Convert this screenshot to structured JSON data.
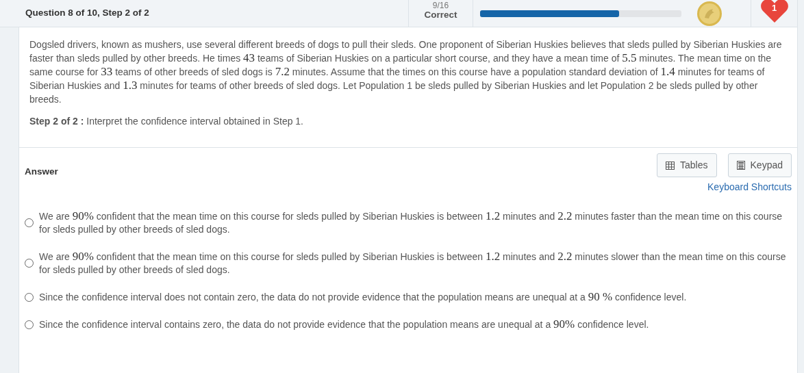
{
  "header": {
    "title": "Question 8 of 10, Step 2 of 2",
    "score": "9/16",
    "result": "Correct",
    "progress": {
      "level": 0.69
    },
    "lives": "1"
  },
  "problem": {
    "parts": [
      {
        "kind": "text",
        "text": "Dogsled drivers, known as mushers, use several different breeds of dogs to pull their sleds. One proponent of Siberian Huskies believes that sleds pulled by Siberian Huskies are faster than sleds pulled by other breeds. He times "
      },
      {
        "kind": "math",
        "text": "43"
      },
      {
        "kind": "text",
        "text": " teams of Siberian Huskies on a particular short course, and they have a mean time of "
      },
      {
        "kind": "math",
        "text": "5.5"
      },
      {
        "kind": "text",
        "text": " minutes. The mean time on the same course for "
      },
      {
        "kind": "math",
        "text": "33"
      },
      {
        "kind": "text",
        "text": " teams of other breeds of sled dogs is "
      },
      {
        "kind": "math",
        "text": "7.2"
      },
      {
        "kind": "text",
        "text": " minutes. Assume that the times on this course have a population standard deviation of "
      },
      {
        "kind": "math",
        "text": "1.4"
      },
      {
        "kind": "text",
        "text": " minutes for teams of Siberian Huskies and "
      },
      {
        "kind": "math",
        "text": "1.3"
      },
      {
        "kind": "text",
        "text": " minutes for teams of other breeds of sled dogs. Let Population 1 be sleds pulled by Siberian Huskies and let Population 2 be sleds pulled by other breeds."
      }
    ],
    "step_label": "Step 2 of 2 :",
    "step_text": "Interpret the confidence interval obtained in Step 1."
  },
  "answer": {
    "label": "Answer",
    "buttons": [
      {
        "kind": "table",
        "label": "Tables"
      },
      {
        "kind": "keypad",
        "label": "Keypad"
      }
    ],
    "shortcuts_link": "Keyboard Shortcuts",
    "options": [
      {
        "selected": false,
        "parts": [
          {
            "kind": "text",
            "text": "We are "
          },
          {
            "kind": "math",
            "text": "90%"
          },
          {
            "kind": "text",
            "text": " confident that the mean time on this course for sleds pulled by Siberian Huskies is between "
          },
          {
            "kind": "math",
            "text": "1.2"
          },
          {
            "kind": "text",
            "text": " minutes and "
          },
          {
            "kind": "math",
            "text": "2.2"
          },
          {
            "kind": "text",
            "text": " minutes faster than the mean time on this course for sleds pulled by other breeds of sled dogs."
          }
        ]
      },
      {
        "selected": false,
        "parts": [
          {
            "kind": "text",
            "text": "We are "
          },
          {
            "kind": "math",
            "text": "90%"
          },
          {
            "kind": "text",
            "text": " confident that the mean time on this course for sleds pulled by Siberian Huskies is between "
          },
          {
            "kind": "math",
            "text": "1.2"
          },
          {
            "kind": "text",
            "text": " minutes and "
          },
          {
            "kind": "math",
            "text": "2.2"
          },
          {
            "kind": "text",
            "text": " minutes slower than the mean time on this course for sleds pulled by other breeds of sled dogs."
          }
        ]
      },
      {
        "selected": false,
        "parts": [
          {
            "kind": "text",
            "text": "Since the confidence interval does not contain zero, the data do not provide evidence that the population means are unequal at a "
          },
          {
            "kind": "math",
            "text": "90 %"
          },
          {
            "kind": "text",
            "text": " confidence level."
          }
        ]
      },
      {
        "selected": false,
        "parts": [
          {
            "kind": "text",
            "text": "Since the confidence interval contains zero, the data do not provide evidence that the population means are unequal at a "
          },
          {
            "kind": "math",
            "text": "90%"
          },
          {
            "kind": "text",
            "text": " confidence level."
          }
        ]
      }
    ]
  }
}
